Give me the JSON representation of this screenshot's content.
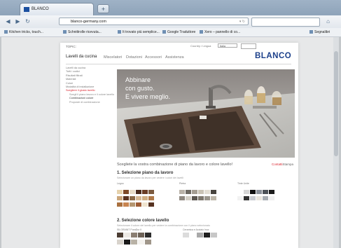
{
  "browser": {
    "tab_title": "BLANCO",
    "new_tab_symbol": "+",
    "url": "blanco-germany.com",
    "nav": {
      "back": "◀",
      "forward": "▶",
      "reload": "↻"
    },
    "bookmarks": [
      "Kitchen tricks, touch...",
      "Schnittrolle ricevuta... ",
      "It trovato più semplice...",
      "Google Traduttore",
      "Xero – pannello di co...",
      "Segnalibri"
    ]
  },
  "site": {
    "top_label": "TOPIC:",
    "country_label": "Country / Lingua",
    "country_value": "Italia",
    "logo": "BLANCO",
    "nav": [
      {
        "label": "Lavelli da cucina",
        "active": true
      },
      {
        "label": "Miscelatori",
        "active": false
      },
      {
        "label": "Dotazioni",
        "active": false
      },
      {
        "label": "Accessori",
        "active": false
      },
      {
        "label": "Assistenza",
        "active": false
      }
    ],
    "sidebar": [
      {
        "label": "Lavelli da cucina",
        "type": "item"
      },
      {
        "label": "Tutti i codici",
        "type": "item"
      },
      {
        "label": "Risultati filtrati",
        "type": "item"
      },
      {
        "label": "Materiali",
        "type": "item"
      },
      {
        "label": "Colori",
        "type": "item"
      },
      {
        "label": "Modalità di installazione",
        "type": "item"
      },
      {
        "label": "Scegliere il giusto lavello",
        "type": "selected"
      },
      {
        "label": "Scegli il piano lavoro e il colore lavello",
        "type": "sub"
      },
      {
        "label": "Combinazioni colore",
        "type": "subsel"
      },
      {
        "label": "Proposte di combinazione",
        "type": "sub"
      }
    ],
    "hero_text": [
      "Abbinare",
      "con gusto.",
      "E vivere meglio."
    ]
  },
  "configurator": {
    "heading": "Scegliete la vostra combinazione di piano da lavoro e colore lavello!",
    "right_link": "Contatti",
    "right_link_suffix": "Stampa",
    "section1_title": "1. Selezione piano da lavoro",
    "section1_sub": "Selezionare un piano da lavoro per vedere i colori dei lavelli",
    "section1_groups": [
      "Legno",
      "Pietra",
      "Tinte Unite"
    ],
    "section2_title": "2. Selezione colore lavello",
    "section2_sub": "Selezionare il colore del lavello per vedere la combinazione con il piano selezionato",
    "section2_groups": [
      "SILGRANIT PuraDur II",
      "Ceramica e Acciaio Inox"
    ],
    "colors": {
      "wood": [
        "#e6d2ac",
        "#caa57a",
        "#a9703f",
        "#7e4a28",
        "#5a3320",
        "#c88450",
        "#e8ddc8",
        "#8c6a48",
        "#b59670",
        "#4a2c1d",
        "#d6b994",
        "#9e5c34",
        "#6a3d25",
        "#cfae83",
        "#f0e4cf",
        "#7b5a3f",
        "#b07a4a",
        "#563220"
      ],
      "stone": [
        "#b9b2a8",
        "#8f8880",
        "#6e6962",
        "#d4cfc6",
        "#a49d92",
        "#5b5650",
        "#c9c2b4",
        "#7d776d",
        "#e2ddd2",
        "#9a958c",
        "#48443f",
        "#bdb6a9"
      ],
      "plain": [
        "#ffffff",
        "#f2f2f2",
        "#d6d6d6",
        "#333333",
        "#101010",
        "#c8cbd0",
        "#8a9099",
        "#e9e5dd",
        "#4c5157",
        "#a8adb3",
        "#1c1c1c",
        "#efefef"
      ],
      "sink": [
        "#4b3d33",
        "#d8d3cc",
        "#ece9e4",
        "#1a1a1a",
        "#8b7f73",
        "#b9b2a6",
        "#6e6358",
        "#f4f2ee",
        "#2d2d2d",
        "#a0968a"
      ],
      "sink2": [
        "#dcdcdc",
        "#ffffff",
        "#a9a9a9",
        "#1f1f1f",
        "#c7c7c7"
      ]
    }
  }
}
